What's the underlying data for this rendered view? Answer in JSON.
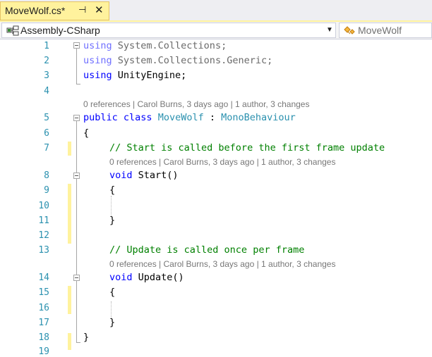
{
  "tab": {
    "title": "MoveWolf.cs*",
    "pin_glyph": "⊣",
    "close_glyph": "✕"
  },
  "navbar": {
    "project": "Assembly-CSharp",
    "class": "MoveWolf",
    "dropdown_glyph": "▼"
  },
  "codelens": {
    "refs": "0 references",
    "author": "Carol Burns, 3 days ago",
    "authors": "1 author, 3 changes",
    "sep": " | "
  },
  "code": {
    "l1": {
      "num": "1",
      "kw": "using",
      "rest": " System.Collections;"
    },
    "l2": {
      "num": "2",
      "kw": "using",
      "rest": " System.Collections.Generic;"
    },
    "l3": {
      "num": "3",
      "kw": "using",
      "rest": " UnityEngine;"
    },
    "l4": {
      "num": "4"
    },
    "l5": {
      "num": "5",
      "kw1": "public",
      "kw2": " class ",
      "name": "MoveWolf",
      "colon": " : ",
      "base": "MonoBehaviour"
    },
    "l6": {
      "num": "6",
      "text": "{"
    },
    "l7": {
      "num": "7",
      "comment": "// Start is called before the first frame update"
    },
    "l8": {
      "num": "8",
      "kw": "void",
      "rest": " Start()"
    },
    "l9": {
      "num": "9",
      "text": "{"
    },
    "l10": {
      "num": "10"
    },
    "l11": {
      "num": "11",
      "text": "}"
    },
    "l12": {
      "num": "12"
    },
    "l13": {
      "num": "13",
      "comment": "// Update is called once per frame"
    },
    "l14": {
      "num": "14",
      "kw": "void",
      "rest": " Update()"
    },
    "l15": {
      "num": "15",
      "text": "{"
    },
    "l16": {
      "num": "16"
    },
    "l17": {
      "num": "17",
      "text": "}"
    },
    "l18": {
      "num": "18",
      "text": "}"
    },
    "l19": {
      "num": "19"
    }
  },
  "colors": {
    "tab_active": "#fff29d",
    "keyword": "#0000ff",
    "type": "#2b91af",
    "comment": "#008000",
    "line_number": "#2b91af",
    "codelens": "#777777"
  }
}
